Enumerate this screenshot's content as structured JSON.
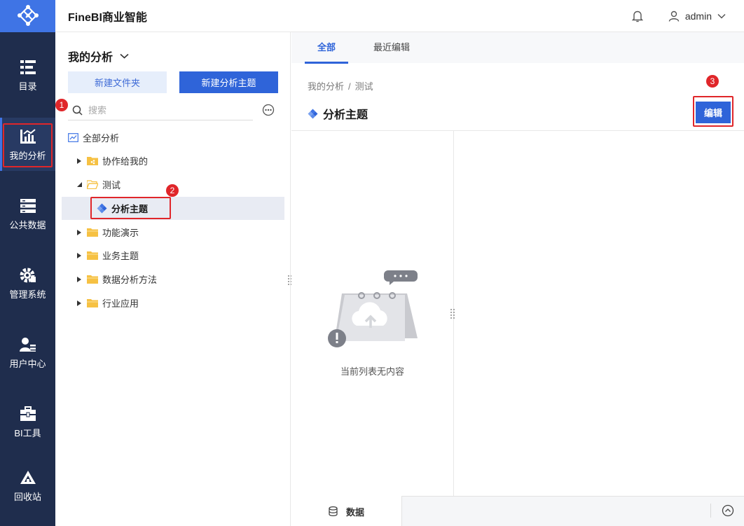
{
  "app": {
    "title": "FineBI商业智能"
  },
  "nav": {
    "items": [
      {
        "label": "目录",
        "icon": "list-icon"
      },
      {
        "label": "我的分析",
        "icon": "analysis-chart-icon",
        "active": true
      },
      {
        "label": "公共数据",
        "icon": "database-icon"
      },
      {
        "label": "管理系统",
        "icon": "gear-icon"
      },
      {
        "label": "用户中心",
        "icon": "user-center-icon"
      },
      {
        "label": "BI工具",
        "icon": "toolbox-icon"
      },
      {
        "label": "回收站",
        "icon": "recycle-icon"
      }
    ]
  },
  "header": {
    "user": "admin"
  },
  "tree": {
    "title": "我的分析",
    "new_folder": "新建文件夹",
    "new_subject": "新建分析主题",
    "search_placeholder": "搜索",
    "items": [
      {
        "label": "全部分析",
        "icon": "analysis-icon"
      },
      {
        "label": "协作给我的",
        "icon": "shared-folder-icon",
        "expanded": false
      },
      {
        "label": "测试",
        "icon": "folder-open-icon",
        "expanded": true
      },
      {
        "label": "分析主题",
        "icon": "subject-icon",
        "selected": true
      },
      {
        "label": "功能演示",
        "icon": "folder-icon"
      },
      {
        "label": "业务主题",
        "icon": "folder-icon"
      },
      {
        "label": "数据分析方法",
        "icon": "folder-icon"
      },
      {
        "label": "行业应用",
        "icon": "folder-icon"
      }
    ]
  },
  "main": {
    "tabs": [
      "全部",
      "最近编辑"
    ],
    "active_tab": 0,
    "breadcrumb": [
      "我的分析",
      "测试"
    ],
    "breadcrumb_sep": "/",
    "title": "分析主题",
    "edit_button": "编辑",
    "empty_text": "当前列表无内容",
    "bottom_tab": "数据"
  },
  "annotations": [
    "1",
    "2",
    "3"
  ],
  "colors": {
    "accent": "#2f64d9",
    "nav_bg": "#1f2d4d",
    "highlight": "#e0262a",
    "folder": "#f6c143"
  }
}
